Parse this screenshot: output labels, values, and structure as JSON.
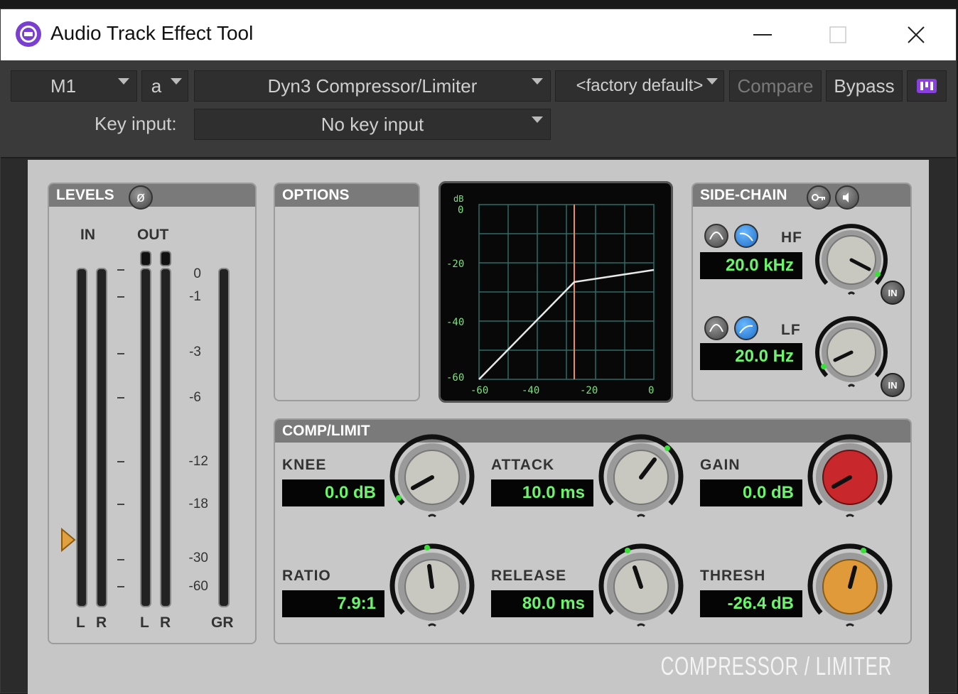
{
  "window": {
    "title": "Audio Track Effect Tool",
    "minimize_symbol": "—",
    "maximize_symbol": "☐",
    "close_symbol": "✕"
  },
  "toolbar": {
    "track": "M1",
    "insert": "a",
    "plugin": "Dyn3 Compressor/Limiter",
    "preset": "<factory default>",
    "compare_label": "Compare",
    "bypass_label": "Bypass",
    "key_input_label": "Key input:",
    "key_input_value": "No key input"
  },
  "levels": {
    "title": "LEVELS",
    "phase_symbol": "ø",
    "in_label": "IN",
    "out_label": "OUT",
    "gr_label": "GR",
    "left_label": "L",
    "right_label": "R",
    "scale": [
      "0",
      "-1",
      "-3",
      "-6",
      "-12",
      "-18",
      "-30",
      "-60"
    ]
  },
  "options": {
    "title": "OPTIONS"
  },
  "graph": {
    "db_label": "dB",
    "y_ticks": [
      "0",
      "-20",
      "-40",
      "-60"
    ],
    "x_ticks": [
      "-60",
      "-40",
      "-20",
      "0"
    ]
  },
  "sidechain": {
    "title": "SIDE-CHAIN",
    "hf_label": "HF",
    "hf_value": "20.0 kHz",
    "lf_label": "LF",
    "lf_value": "20.0 Hz",
    "in_label": "IN"
  },
  "comp": {
    "title": "COMP/LIMIT",
    "knee_label": "KNEE",
    "knee_value": "0.0 dB",
    "attack_label": "ATTACK",
    "attack_value": "10.0 ms",
    "gain_label": "GAIN",
    "gain_value": "0.0 dB",
    "ratio_label": "RATIO",
    "ratio_value": "7.9:1",
    "release_label": "RELEASE",
    "release_value": "80.0 ms",
    "thresh_label": "THRESH",
    "thresh_value": "-26.4 dB"
  },
  "brand": "COMPRESSOR / LIMITER",
  "colors": {
    "lcd_text": "#6cf56c",
    "gain_knob": "#c8282c",
    "thresh_knob": "#e09a3a",
    "threshold_line": "#e8905a",
    "plugin_icon": "#7a3fd0"
  }
}
